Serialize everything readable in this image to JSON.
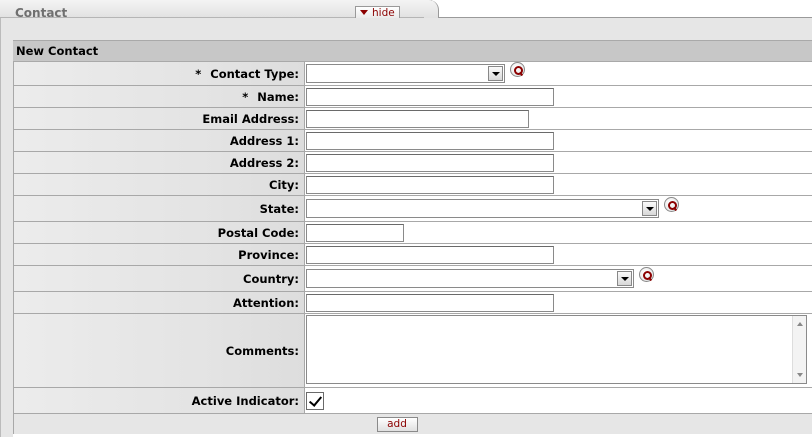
{
  "tab": {
    "title": "Contact",
    "hide_label": "hide"
  },
  "section": {
    "title": "New Contact"
  },
  "fields": {
    "contact_type": {
      "label": "Contact Type:",
      "required": "*",
      "value": ""
    },
    "name": {
      "label": "Name:",
      "required": "*",
      "value": ""
    },
    "email": {
      "label": "Email Address:",
      "value": ""
    },
    "address1": {
      "label": "Address 1:",
      "value": ""
    },
    "address2": {
      "label": "Address 2:",
      "value": ""
    },
    "city": {
      "label": "City:",
      "value": ""
    },
    "state": {
      "label": "State:",
      "value": ""
    },
    "postal_code": {
      "label": "Postal Code:",
      "value": ""
    },
    "province": {
      "label": "Province:",
      "value": ""
    },
    "country": {
      "label": "Country:",
      "value": ""
    },
    "attention": {
      "label": "Attention:",
      "value": ""
    },
    "comments": {
      "label": "Comments:",
      "value": ""
    },
    "active": {
      "label": "Active Indicator:",
      "checked": true
    }
  },
  "actions": {
    "add_label": "add"
  },
  "colors": {
    "accent": "#8b0000",
    "header_bg": "#c7c7c7",
    "tab_bg": "#e6e6e6"
  }
}
